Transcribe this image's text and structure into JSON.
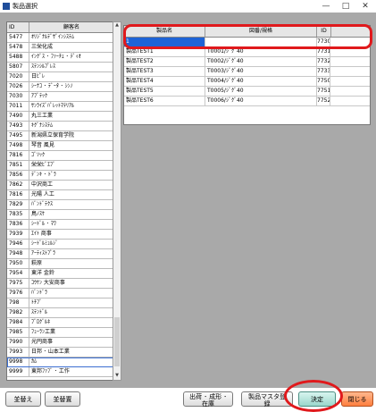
{
  "window": {
    "title": "製品選択",
    "min": "—",
    "max": "□",
    "close": "✕"
  },
  "customer_list": {
    "headers": {
      "code": "ID",
      "name": "顧客名"
    },
    "rows": [
      {
        "code": "5477",
        "name": "ｵﾘｼﾞﾅﾙﾃﾞｻﾞｲﾝｼｽﾃﾑ"
      },
      {
        "code": "5478",
        "name": "三栄化成"
      },
      {
        "code": "5488",
        "name": "ｲﾝｸﾞｽ ･ ﾌｧｰﾁｪ ･ ﾃﾞｨｵ"
      },
      {
        "code": "5807",
        "name": "ｽﾃﾝｼﾙﾌﾟﾚｽ"
      },
      {
        "code": "7020",
        "name": "日ﾋﾟﾚ"
      },
      {
        "code": "7026",
        "name": "ｼｰﾅｺ ･ ﾃﾞｰﾀ ･ ｼﾝﾉ"
      },
      {
        "code": "7030",
        "name": "ｱﾌﾞﾃｯｸ"
      },
      {
        "code": "7011",
        "name": "ｻﾝﾗｲｽﾞﾊﾟﾚｯﾄﾏﾃﾘｱﾙ"
      },
      {
        "code": "7490",
        "name": "丸三工業"
      },
      {
        "code": "7493",
        "name": "ｷｸﾞﾅｼｽﾃﾑ"
      },
      {
        "code": "7495",
        "name": "新潟県立保育学院"
      },
      {
        "code": "7498",
        "name": "琴音 風見"
      },
      {
        "code": "7816",
        "name": "ｺﾞｿｯｸ"
      },
      {
        "code": "7851",
        "name": "栄栄ﾋﾞｴﾌﾞ"
      },
      {
        "code": "7856",
        "name": "ﾃﾞﾝｷ ･ ﾄﾞﾗ"
      },
      {
        "code": "7862",
        "name": "中沢商工"
      },
      {
        "code": "7816",
        "name": "光陽 人工"
      },
      {
        "code": "7829",
        "name": "ﾊﾞﾝﾄﾞﾃｸｽ"
      },
      {
        "code": "7835",
        "name": "鳥ﾉｽｹ"
      },
      {
        "code": "7836",
        "name": "ｼｰﾄﾞﾙ ･ ﾏﾜ"
      },
      {
        "code": "7939",
        "name": "ｴｲﾄ 商事"
      },
      {
        "code": "7946",
        "name": "ｼｰﾄﾞﾙﾐｭﾙｼﾞ"
      },
      {
        "code": "7948",
        "name": "ｱｰﾃｨｽﾄﾌﾟﾗ"
      },
      {
        "code": "7950",
        "name": "萩原"
      },
      {
        "code": "7954",
        "name": "東洋 金鈴"
      },
      {
        "code": "7975",
        "name": "ｺｳｹﾝ 大安商事"
      },
      {
        "code": "7976",
        "name": "ﾊﾞﾝﾄﾞﾗ"
      },
      {
        "code": "798",
        "name": "ﾄﾁﾌﾞ"
      },
      {
        "code": "7982",
        "name": "ｽﾃﾝﾄﾞﾙ"
      },
      {
        "code": "7984",
        "name": "ﾌﾞﾛｸﾞﾙﾈ"
      },
      {
        "code": "7985",
        "name": "ﾌｭｰﾗﾝ工業"
      },
      {
        "code": "7990",
        "name": "光円商事"
      },
      {
        "code": "7993",
        "name": "日邦 ･ 山本工業"
      },
      {
        "code": "9998",
        "name": "ｶﾑ"
      },
      {
        "code": "9999",
        "name": "東邦ﾌｧﾌﾞ ･ 工作"
      }
    ],
    "selected_index": 33
  },
  "product_table": {
    "headers": {
      "name": "製品名",
      "drawing": "図番/規格",
      "cd": "ID"
    },
    "rows": [
      {
        "name": "1",
        "drawing": "",
        "cd": "7730"
      },
      {
        "name": "製品TEST1",
        "drawing": "T0001/ｼﾞｸﾞ40",
        "cd": "7731"
      },
      {
        "name": "製品TEST2",
        "drawing": "T0002/ｼﾞｸﾞ40",
        "cd": "7732"
      },
      {
        "name": "製品TEST3",
        "drawing": "T0003/ｼﾞｸﾞ40",
        "cd": "7733"
      },
      {
        "name": "製品TEST4",
        "drawing": "T0004/ｼﾞｸﾞ40",
        "cd": "7750"
      },
      {
        "name": "製品TEST5",
        "drawing": "T0005/ｼﾞｸﾞ40",
        "cd": "7751"
      },
      {
        "name": "製品TEST6",
        "drawing": "T0006/ｼﾞｸﾞ40",
        "cd": "7752"
      }
    ],
    "selected_index": 0
  },
  "buttons": {
    "sort1": "並替え",
    "sort2": "並替置",
    "ship_line1": "出荷 ･ 成形 ･",
    "ship_line2": "在庫",
    "master_line1": "製品マスタ登",
    "master_line2": "録",
    "ok": "決定",
    "close": "閉じる"
  },
  "colors": {
    "selection": "#1e63d6",
    "annotation_red": "#e0191c",
    "ok_button": "#9bd8cc",
    "close_button": "#ff7f3f"
  }
}
